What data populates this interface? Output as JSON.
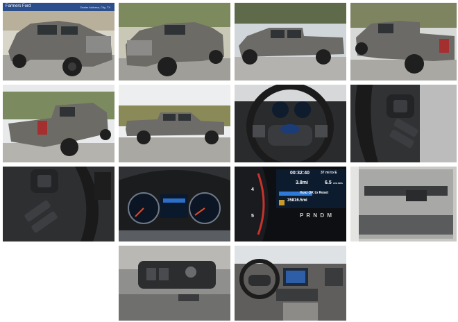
{
  "gallery": {
    "photos": [
      {
        "name": "exterior-front-left-banner",
        "banner": {
          "dealer": "Farmers Ford",
          "address": "Dealer Address, City, TX"
        }
      },
      {
        "name": "exterior-front-right"
      },
      {
        "name": "exterior-side-left"
      },
      {
        "name": "exterior-rear-right"
      },
      {
        "name": "exterior-rear-left"
      },
      {
        "name": "exterior-profile-left"
      },
      {
        "name": "steering-wheel-cluster"
      },
      {
        "name": "steering-wheel-right-controls"
      },
      {
        "name": "steering-wheel-left-controls"
      },
      {
        "name": "instrument-cluster"
      },
      {
        "name": "cluster-display-closeup",
        "display": {
          "time": "00:32:40",
          "range": "37 mi to E",
          "trip": "3.8mi",
          "avg": "6.5",
          "avg_unit": "AVG MPG",
          "prompt": "Hold OK to Reset",
          "odometer": "35816.5mi",
          "gear": "P R N D M",
          "gauge_nums": [
            "4",
            "5"
          ]
        }
      },
      {
        "name": "door-panel"
      },
      {
        "name": "door-window-switches"
      },
      {
        "name": "dashboard-center-console"
      }
    ]
  },
  "colors": {
    "truck": "#6b6a66",
    "sky": "#e9ecee",
    "road": "#a8a7a2",
    "grass": "#8f8a5c",
    "dash": "#2b2c2e"
  }
}
